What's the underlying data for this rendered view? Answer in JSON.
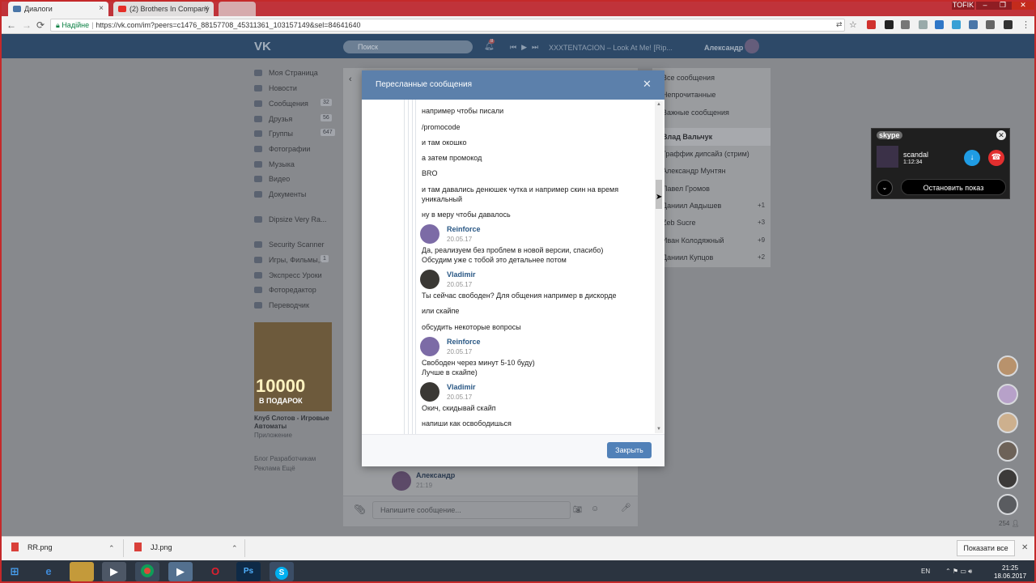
{
  "browser": {
    "tabs": [
      {
        "label": "Диалоги",
        "active": true
      },
      {
        "label": "(2) Brothers In Company",
        "active": false
      }
    ],
    "profile_label": "TOFIK",
    "url": {
      "secure_label": "Надійне",
      "text": "https://vk.com/im?peers=c1476_88157708_45311361_103157149&sel=84641640"
    }
  },
  "vk": {
    "logo": "VK",
    "search_placeholder": "Поиск",
    "notification_count": "8",
    "player_text": "XXXTENTACION – Look At Me! [Rip...",
    "user_name": "Александр",
    "sidebar": [
      {
        "label": "Моя Страница",
        "badge": ""
      },
      {
        "label": "Новости",
        "badge": ""
      },
      {
        "label": "Сообщения",
        "badge": "32"
      },
      {
        "label": "Друзья",
        "badge": "56"
      },
      {
        "label": "Группы",
        "badge": "647"
      },
      {
        "label": "Фотографии",
        "badge": ""
      },
      {
        "label": "Музыка",
        "badge": ""
      },
      {
        "label": "Видео",
        "badge": ""
      },
      {
        "label": "Документы",
        "badge": ""
      }
    ],
    "sidebar_group": "Dipsize Very Ra...",
    "sidebar_apps": [
      {
        "label": "Security Scanner",
        "badge": ""
      },
      {
        "label": "Игры, Фильмы,...",
        "badge": "1"
      },
      {
        "label": "Экспресс Уроки",
        "badge": ""
      },
      {
        "label": "Фоторедактор",
        "badge": ""
      },
      {
        "label": "Переводчик",
        "badge": ""
      }
    ],
    "ad": {
      "big": "10000",
      "sub": "В ПОДАРОК",
      "title": "Клуб Слотов - Игровые Автоматы",
      "category": "Приложение"
    },
    "footer_links": "Блог   Разработчикам\nРеклама   Ещё",
    "filters": [
      "Все сообщения",
      "Непрочитанные",
      "Важные сообщения"
    ],
    "dialogs": [
      {
        "name": "Влад Вальчук",
        "count": ""
      },
      {
        "name": "Граффик дипсайз (стрим)",
        "count": ""
      },
      {
        "name": "Александр Мунтян",
        "count": ""
      },
      {
        "name": "Павел Громов",
        "count": ""
      },
      {
        "name": "Даниил Авдышев",
        "count": "+1"
      },
      {
        "name": "Zeb Sucre",
        "count": "+3"
      },
      {
        "name": "Иван Колодяжный",
        "count": "+9"
      },
      {
        "name": "Даниил Купцов",
        "count": "+2"
      }
    ],
    "behind_message": {
      "author": "Александр",
      "time": "21:19"
    },
    "composer_placeholder": "Напишите сообщение..."
  },
  "modal": {
    "title": "Пересланные сообщения",
    "close_button": "Закрыть",
    "messages": [
      "например чтобы писали",
      "/promocode",
      "и там окошко",
      "а затем промокод",
      "BRO",
      "и там давались денюшек чутка и например скин на время",
      "уникальный",
      "ну в меру чтобы давалось"
    ],
    "posts": [
      {
        "author": "Reinforce",
        "date": "20.05.17",
        "lines": [
          "Да, реализуем без проблем в новой версии, спасибо)",
          "Обсудим уже с тобой это детальнее потом"
        ]
      },
      {
        "author": "Vladimir",
        "date": "20.05.17",
        "lines": [
          "Ты сейчас свободен? Для общения например в дискорде",
          "или скайпе",
          "обсудить некоторые вопросы"
        ]
      },
      {
        "author": "Reinforce",
        "date": "20.05.17",
        "lines": [
          "Свободен через минут 5-10 буду)",
          "Лучше в скайпе)"
        ]
      },
      {
        "author": "Vladimir",
        "date": "20.05.17",
        "lines": [
          "Окич, скидывай скайп",
          "напиши как освободишься"
        ]
      }
    ]
  },
  "skype": {
    "brand": "skype",
    "caller": "scandal",
    "duration": "1:12:34",
    "stop_label": "Остановить показ"
  },
  "online_count": "254",
  "downloads": {
    "items": [
      "RR.png",
      "JJ.png"
    ],
    "show_all": "Показати все"
  },
  "taskbar": {
    "language": "EN",
    "time": "21:25",
    "date": "18.06.2017"
  }
}
